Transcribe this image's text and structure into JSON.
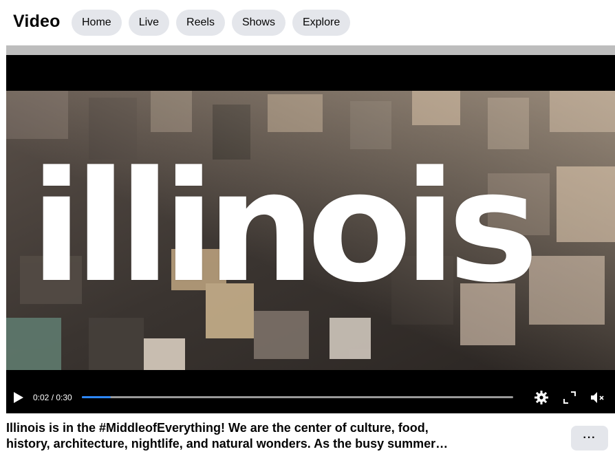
{
  "header": {
    "title": "Video",
    "nav": [
      "Home",
      "Live",
      "Reels",
      "Shows",
      "Explore"
    ]
  },
  "player": {
    "logo_text": "illinois",
    "time_display": "0:02 / 0:30",
    "progress_fraction": 0.067,
    "icons": [
      "play-icon",
      "settings-icon",
      "fullscreen-icon",
      "mute-icon"
    ]
  },
  "post": {
    "caption_line1": "Illinois is in the #MiddleofEverything! We are the center of culture, food,",
    "caption_line2": "history, architecture, nightlife, and natural wonders. As the busy summer…",
    "more_label": "···"
  },
  "colors": {
    "accent": "#2d88ff",
    "pill_bg": "#e4e6eb",
    "text": "#050505"
  }
}
